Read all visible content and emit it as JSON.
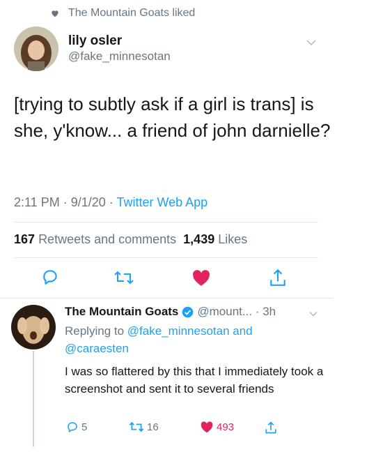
{
  "social_context": {
    "text": "The Mountain Goats liked",
    "icon": "heart-icon"
  },
  "tweet": {
    "author_name": "lily osler",
    "author_handle": "@fake_minnesotan",
    "text": "[trying to subtly ask if a girl is trans] is she, y'know... a friend of john darnielle?",
    "time": "2:11 PM",
    "date": "9/1/20",
    "source": "Twitter Web App",
    "retweets_count": "167",
    "retweets_label": "Retweets and comments",
    "likes_count": "1,439",
    "likes_label": "Likes",
    "actions": [
      "reply-icon",
      "retweet-icon",
      "like-icon",
      "share-icon"
    ]
  },
  "reply": {
    "author_name": "The Mountain Goats",
    "author_handle": "@mount...",
    "time": "3h",
    "replying_prefix": "Replying to",
    "replying_user1": "@fake_minnesotan",
    "replying_and": "and",
    "replying_user2": "@caraesten",
    "text": "I was so flattered by this that I immediately took a screenshot and sent it to several friends",
    "reply_count": "5",
    "retweet_count": "16",
    "like_count": "493"
  },
  "colors": {
    "accent": "#1da1f2",
    "like": "#e0245e",
    "secondary_text": "#657786",
    "divider": "#e1e8ed"
  }
}
